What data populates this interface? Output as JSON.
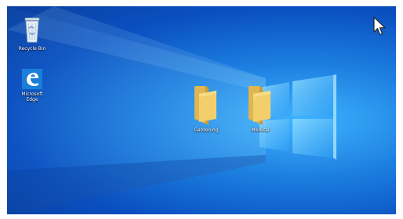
{
  "desktop": {
    "icons": [
      {
        "name": "recycle-bin",
        "label": "Recycle Bin",
        "icon": "recycle-bin-icon"
      },
      {
        "name": "microsoft-edge",
        "label": "Microsoft\nEdge",
        "icon": "edge-icon"
      },
      {
        "name": "folder-gardening",
        "label": "Gardening",
        "icon": "folder-icon"
      },
      {
        "name": "folder-medical",
        "label": "Medical",
        "icon": "folder-icon"
      }
    ]
  },
  "colors": {
    "wallpaper_dark": "#0a3f9e",
    "wallpaper_light": "#3fb3ff",
    "edge_blue": "#1a7fd9",
    "folder_yellow": "#f3cf6b"
  }
}
